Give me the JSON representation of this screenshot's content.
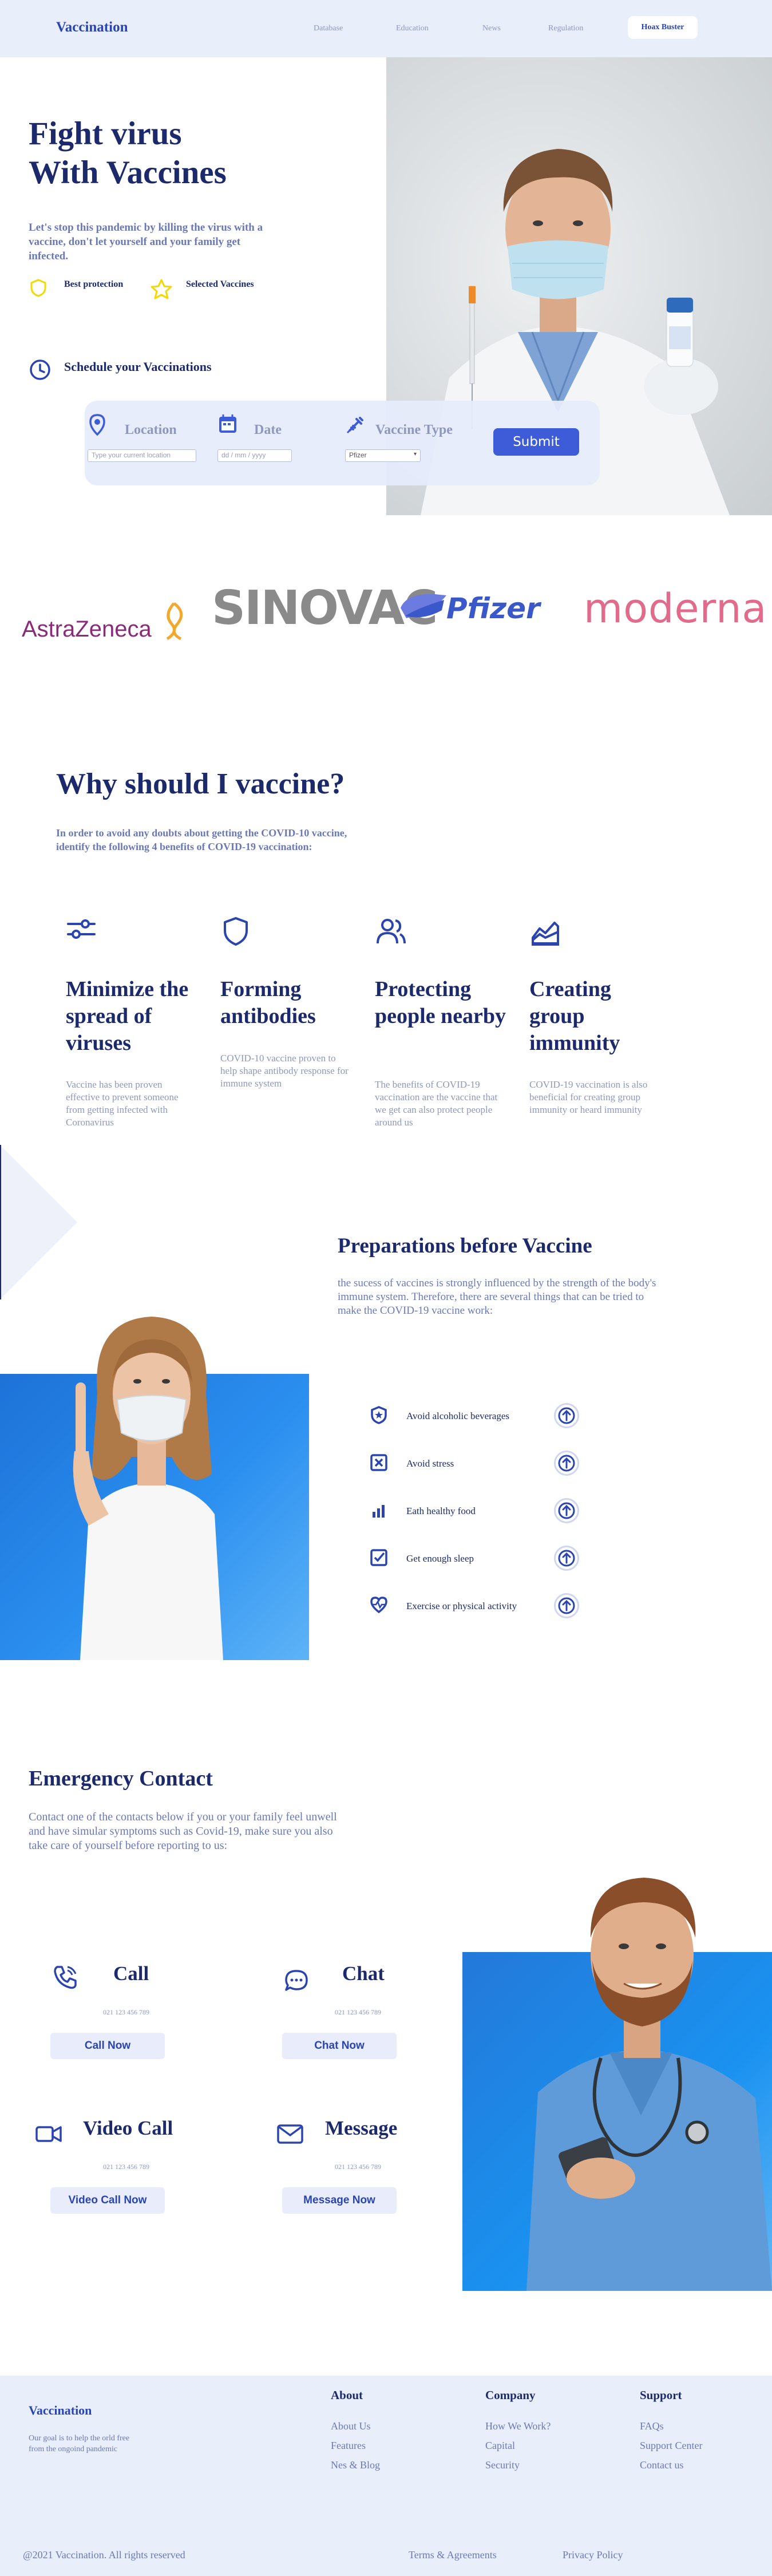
{
  "header": {
    "brand": "Vaccination",
    "nav": [
      "Database",
      "Education",
      "News",
      "Regulation"
    ],
    "cta": "Hoax Buster"
  },
  "hero": {
    "title_line1": "Fight virus",
    "title_line2": "With Vaccines",
    "subtitle": "Let's stop this pandemic by killing the virus with a vaccine, don't let yourself and your family get infected.",
    "badges": [
      "Best protection",
      "Selected Vaccines"
    ],
    "schedule_label": "Schedule your Vaccinations",
    "form": {
      "location_label": "Location",
      "location_placeholder": "Type your current location",
      "date_label": "Date",
      "date_value": "dd / mm / yyyy",
      "vaccine_label": "Vaccine Type",
      "vaccine_selected": "Pfizer",
      "submit_label": "Submit"
    }
  },
  "partners": [
    "AstraZeneca",
    "SINOVAC",
    "Pfizer",
    "moderna"
  ],
  "why": {
    "title": "Why should I vaccine?",
    "subtitle": "In order to avoid any doubts about getting the COVID-10 vaccine, identify the following 4 benefits of COVID-19 vaccination:",
    "features": [
      {
        "title": "Minimize the spread of viruses",
        "text": "Vaccine has been proven effective to prevent someone from getting infected with Coronavirus",
        "icon": "sliders-icon"
      },
      {
        "title": "Forming antibodies",
        "text": "COVID-10 vaccine proven to help shape antibody response for immune system",
        "icon": "shield-icon"
      },
      {
        "title": "Protecting people nearby",
        "text": "The benefits of COVID-19 vaccination are the vaccine that we get can also protect people around us",
        "icon": "people-icon"
      },
      {
        "title": "Creating group immunity",
        "text": "COVID-19 vaccination is also beneficial for creating group immunity or heard immunity",
        "icon": "area-chart-icon"
      }
    ]
  },
  "prep": {
    "title": "Preparations before Vaccine",
    "text": "the sucess of vaccines is strongly influenced by the strength of the body's immune system. Therefore, there are several things that can be tried to make the COVID-19 vaccine work:",
    "items": [
      "Avoid alcoholic beverages",
      "Avoid stress",
      "Eath healthy food",
      "Get enough sleep",
      "Exercise or physical activity"
    ]
  },
  "emergency": {
    "title": "Emergency Contact",
    "text": "Contact one of the contacts below if you or your family feel unwell and have simular symptoms such as Covid-19, make sure you also take care of yourself before reporting to us:",
    "contacts": [
      {
        "title": "Call",
        "number": "021 123 456 789",
        "button": "Call Now",
        "icon": "phone-icon"
      },
      {
        "title": "Chat",
        "number": "021 123 456 789",
        "button": "Chat Now",
        "icon": "chat-icon"
      },
      {
        "title": "Video Call",
        "number": "021 123 456 789",
        "button": "Video Call Now",
        "icon": "video-icon"
      },
      {
        "title": "Message",
        "number": "021 123 456 789",
        "button": "Message Now",
        "icon": "mail-icon"
      }
    ]
  },
  "footer": {
    "brand": "Vaccination",
    "desc": "Our goal is to help the orld free from the ongoind pandemic",
    "columns": [
      {
        "title": "About",
        "links": [
          "About Us",
          "Features",
          "Nes & Blog"
        ]
      },
      {
        "title": "Company",
        "links": [
          "How We Work?",
          "Capital",
          "Security"
        ]
      },
      {
        "title": "Support",
        "links": [
          "FAQs",
          "Support Center",
          "Contact us"
        ]
      }
    ],
    "copyright": "@2021 Vaccination. All rights reserved",
    "terms": "Terms & Agreements",
    "privacy": "Privacy Policy"
  },
  "colors": {
    "primary": "#2a44b0",
    "heading": "#1c2a6b",
    "muted": "#8e97bc",
    "accent_yellow": "#f5d800",
    "header_bg": "#e9eefb",
    "button_blue": "#3e5bd8"
  }
}
